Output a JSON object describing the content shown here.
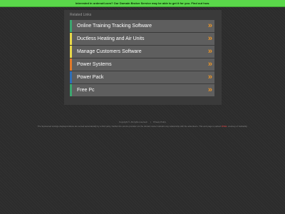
{
  "banner": {
    "text": "Interested in ordenutl.com? Our Domain Broker Service may be able to get it for you.",
    "link": "Find out how."
  },
  "related": {
    "title": "Related Links",
    "items": [
      {
        "label": "Online Training Tracking Software",
        "color": "#3ca66f"
      },
      {
        "label": "Ductless Heating and Air Units",
        "color": "#e8d84a"
      },
      {
        "label": "Manage Customers Software",
        "color": "#e8d84a"
      },
      {
        "label": "Power Systems",
        "color": "#e07a2a"
      },
      {
        "label": "Power Pack",
        "color": "#2f6fb8"
      },
      {
        "label": "Free Pc",
        "color": "#3ca66f"
      }
    ],
    "chevron": "»"
  },
  "footer": {
    "copyright": "Copyright ©. All rights reserved.",
    "separator": "|",
    "privacy": "Privacy Policy",
    "parked_prefix": "The Sponsored Listings displayed above are served automatically by a third party. Neither the service provider nor the domain owner maintain any relationship with the advertisers. This web page is parked",
    "parked_link": "FREE",
    "parked_suffix": ", courtesy of GoDaddy."
  },
  "colors": {
    "banner_bg": "#5ad84a",
    "page_bg": "#2c2c2c",
    "panel_bg": "#3a3a3a",
    "item_bg": "#5e5e5e",
    "chevron": "#e8952a"
  }
}
